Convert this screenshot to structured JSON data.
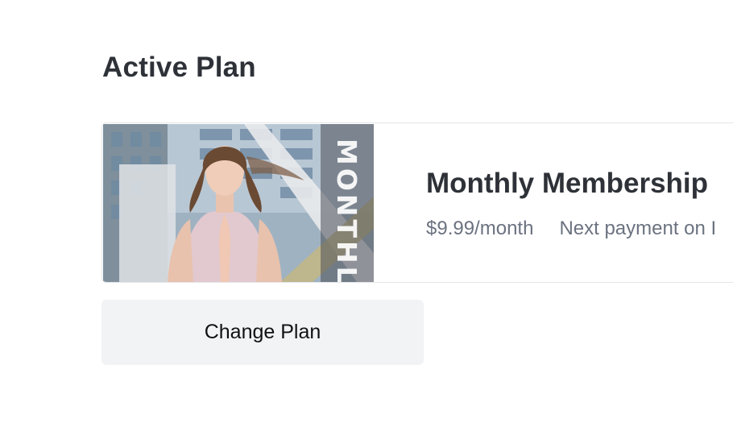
{
  "section": {
    "title": "Active Plan"
  },
  "plan": {
    "image_label": "MONTHLY",
    "name": "Monthly Membership",
    "price": "$9.99/month",
    "next_payment": "Next payment on I"
  },
  "actions": {
    "change_plan_label": "Change Plan"
  }
}
